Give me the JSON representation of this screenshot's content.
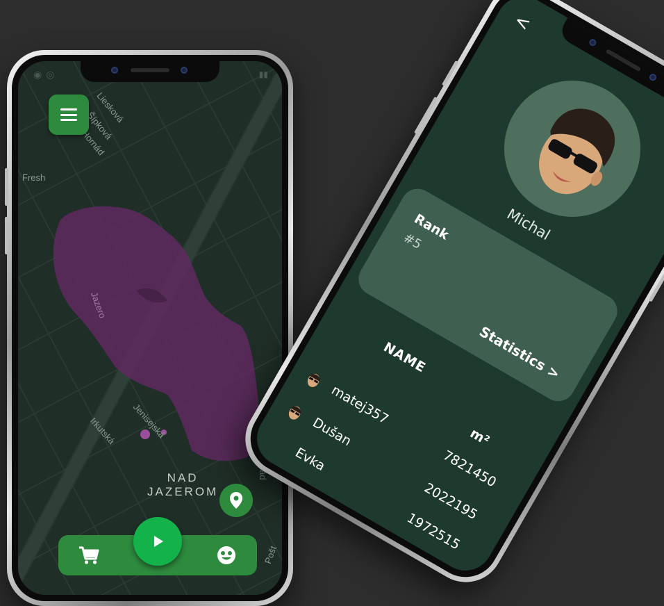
{
  "map_screen": {
    "streets": [
      "Liesková",
      "Šípková",
      "Hornád",
      "Jenisejská",
      "Irkutská",
      "Hornád",
      "Pošt",
      "Fresh"
    ],
    "poi_label": "Jazero",
    "district_label_line1": "NAD",
    "district_label_line2": "JAZEROM",
    "territory_color": "#5e2a5e",
    "accent_color": "#2e8b3e",
    "play_color": "#13b24a",
    "icons": {
      "menu": "hamburger-icon",
      "location": "location-pin-icon",
      "shop": "cart-icon",
      "profile": "face-icon",
      "start": "play-icon"
    }
  },
  "profile_screen": {
    "back_label": "<",
    "user_name": "Michal",
    "rank": {
      "label": "Rank",
      "value": "#5"
    },
    "statistics_label": "Statistics >",
    "leaderboard": {
      "col_name": "NAME",
      "col_area": "m²",
      "rows": [
        {
          "name": "matej357",
          "area": "7821450"
        },
        {
          "name": "Dušan",
          "area": "2022195"
        },
        {
          "name": "Evka",
          "area": "1972515"
        }
      ]
    }
  }
}
